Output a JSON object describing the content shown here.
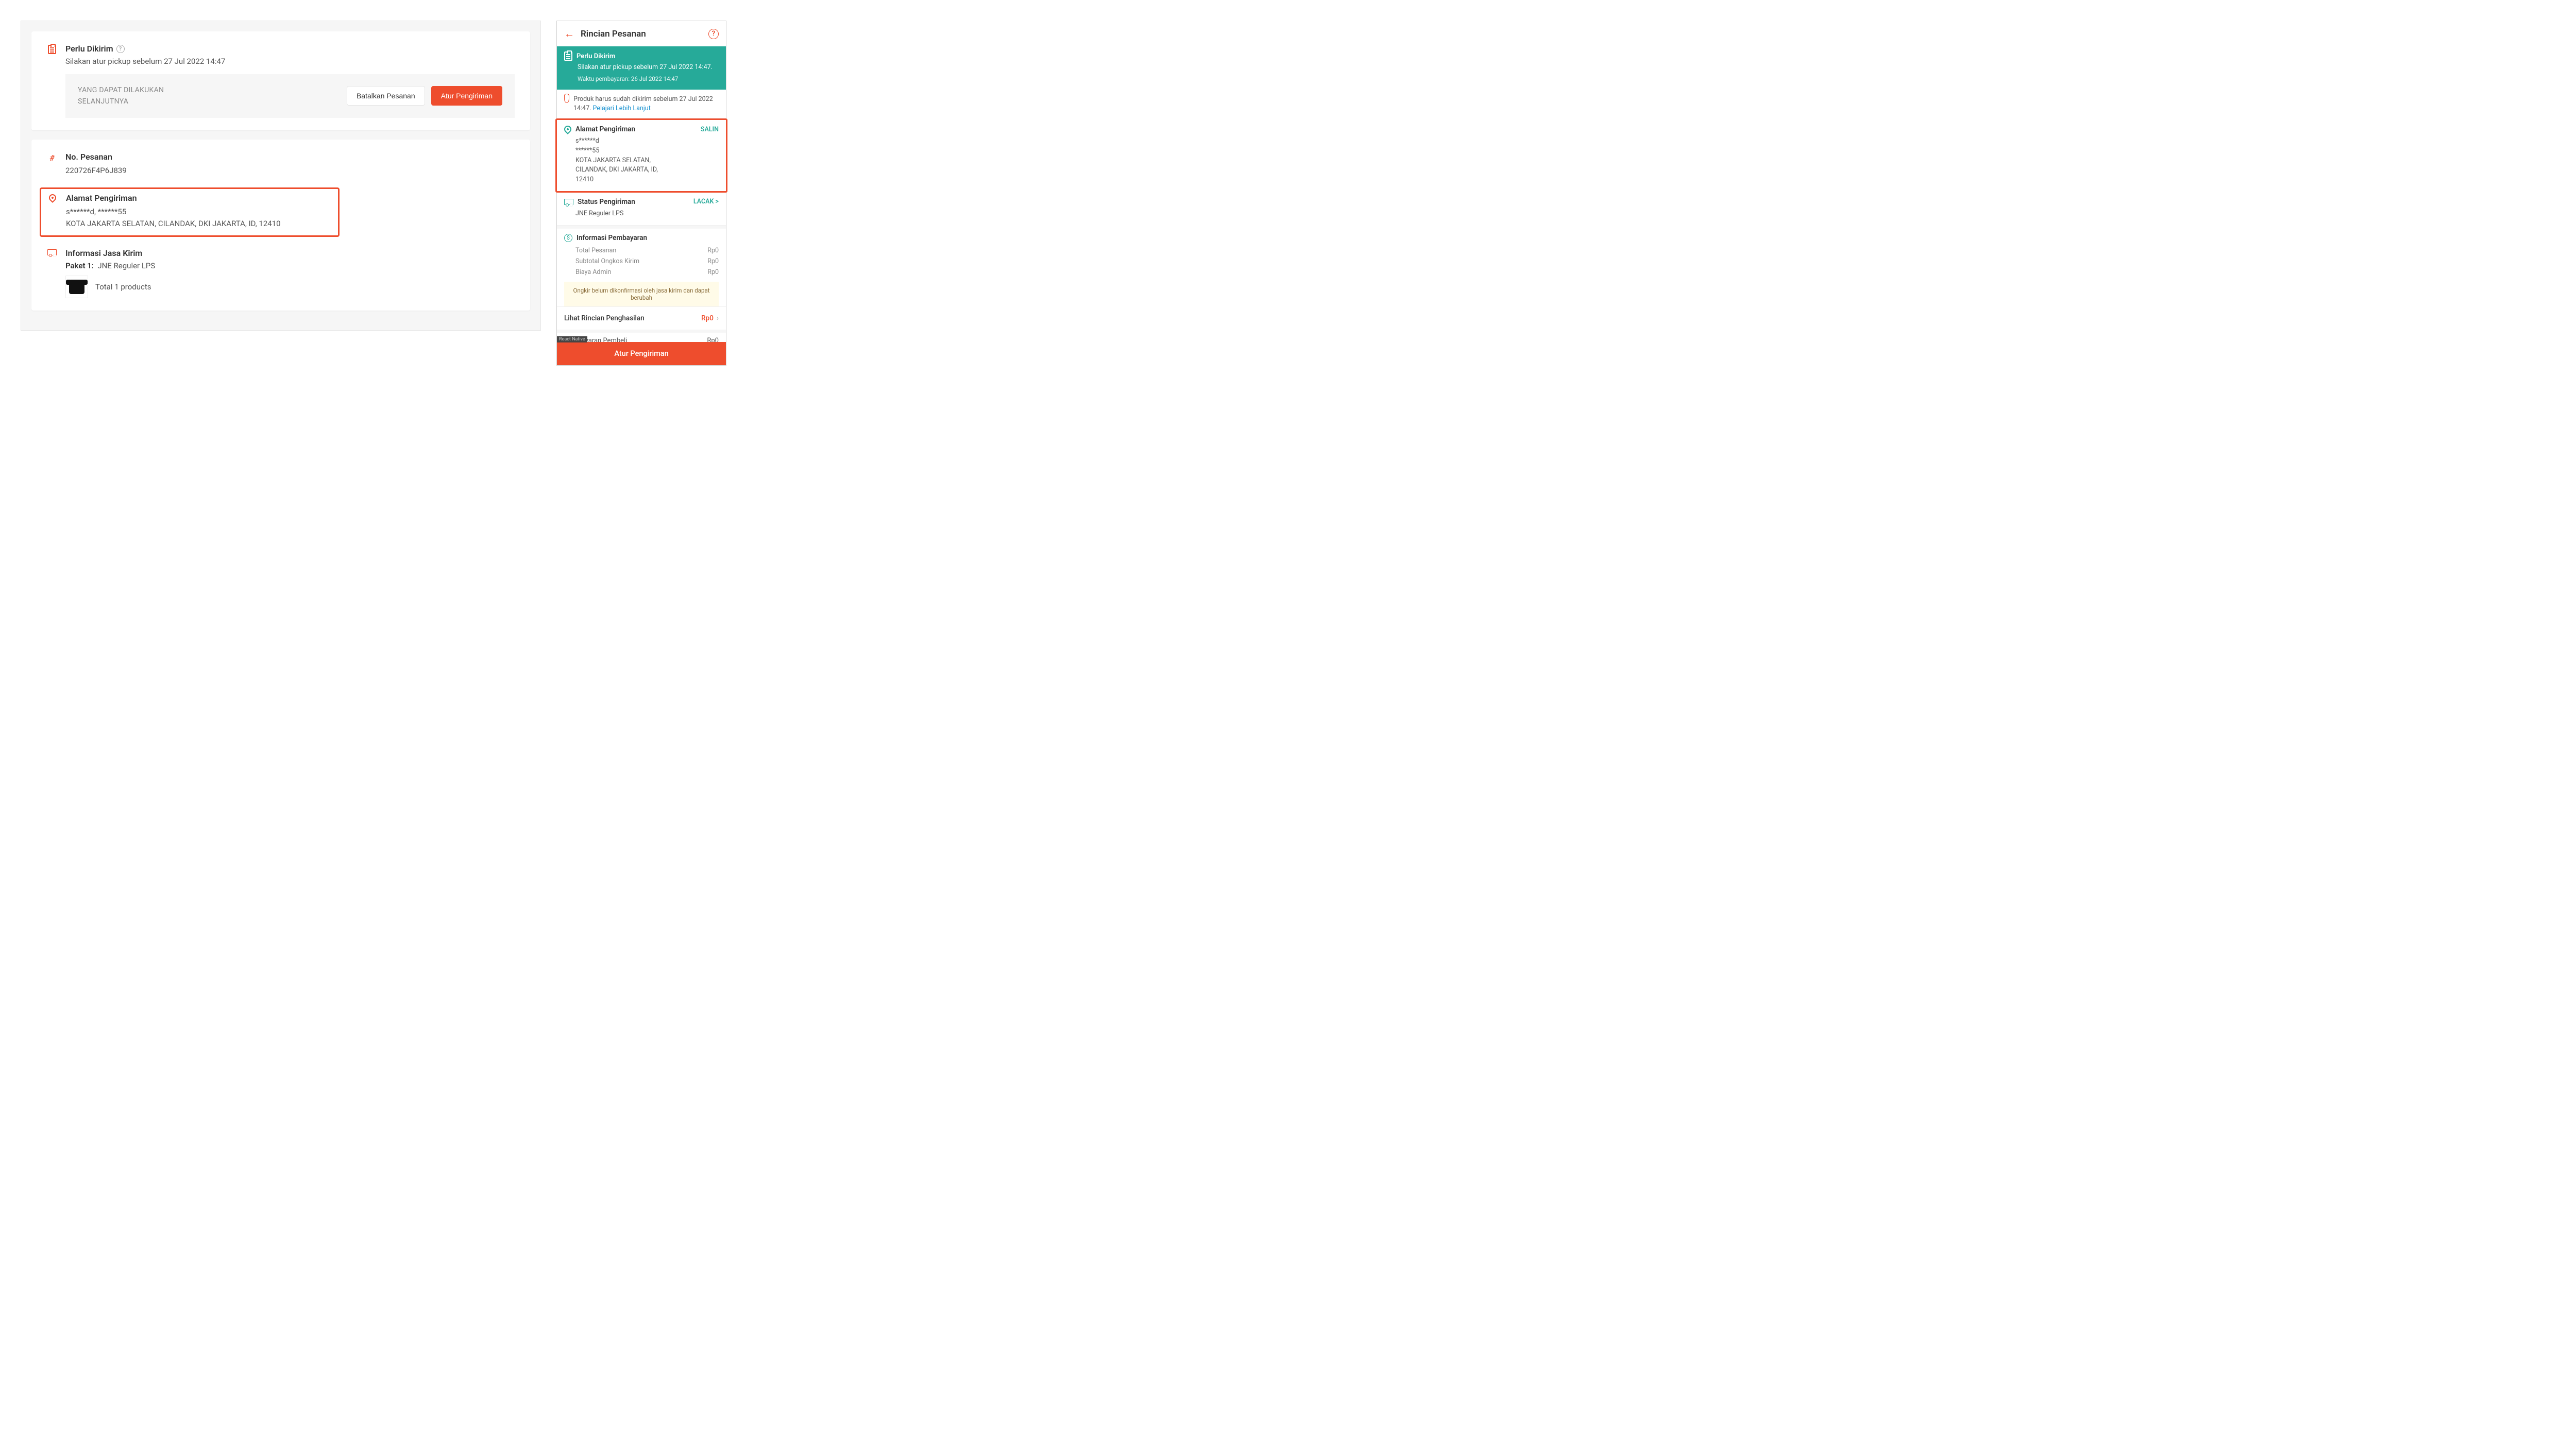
{
  "desktop": {
    "status": {
      "title": "Perlu Dikirim",
      "subtitle": "Silakan atur pickup sebelum 27 Jul 2022 14:47",
      "next_action_label_1": "YANG DAPAT DILAKUKAN",
      "next_action_label_2": "SELANJUTNYA",
      "btn_cancel": "Batalkan Pesanan",
      "btn_arrange": "Atur Pengiriman"
    },
    "order": {
      "title": "No. Pesanan",
      "number": "220726F4P6J839"
    },
    "address": {
      "title": "Alamat Pengiriman",
      "line1": "s******d, ******55",
      "line2": "KOTA JAKARTA SELATAN, CILANDAK, DKI JAKARTA, ID, 12410"
    },
    "courier": {
      "title": "Informasi Jasa Kirim",
      "pkg_label": "Paket 1:",
      "pkg_name": "JNE Reguler LPS",
      "total_products": "Total 1 products"
    }
  },
  "mobile": {
    "header": {
      "title": "Rincian Pesanan"
    },
    "status": {
      "title": "Perlu Dikirim",
      "line1": "Silakan atur pickup sebelum 27 Jul 2022 14:47.",
      "line2": "Waktu pembayaran: 26 Jul 2022 14:47"
    },
    "notice": {
      "text": "Produk harus sudah dikirim sebelum 27 Jul 2022 14:47.",
      "link": "Pelajari Lebih Lanjut"
    },
    "address": {
      "title": "Alamat Pengiriman",
      "action": "SALIN",
      "l1": "s******d",
      "l2": "******55",
      "l3": "KOTA JAKARTA SELATAN,",
      "l4": "CILANDAK, DKI JAKARTA, ID,",
      "l5": "12410"
    },
    "shipping": {
      "title": "Status Pengiriman",
      "action": "LACAK >",
      "courier": "JNE Reguler LPS"
    },
    "payment": {
      "title": "Informasi Pembayaran",
      "rows": [
        {
          "label": "Total Pesanan",
          "value": "Rp0"
        },
        {
          "label": "Subtotal Ongkos Kirim",
          "value": "Rp0"
        },
        {
          "label": "Biaya Admin",
          "value": "Rp0"
        }
      ],
      "warn": "Ongkir belum dikonfirmasi oleh jasa kirim dan dapat berubah"
    },
    "income": {
      "label": "Lihat Rincian Penghasilan",
      "value": "Rp0"
    },
    "truncated": {
      "label": "Pembayaran Pembeli",
      "value": "Rp0"
    },
    "footer_btn": "Atur Pengiriman",
    "rn_badge": "React Native"
  }
}
